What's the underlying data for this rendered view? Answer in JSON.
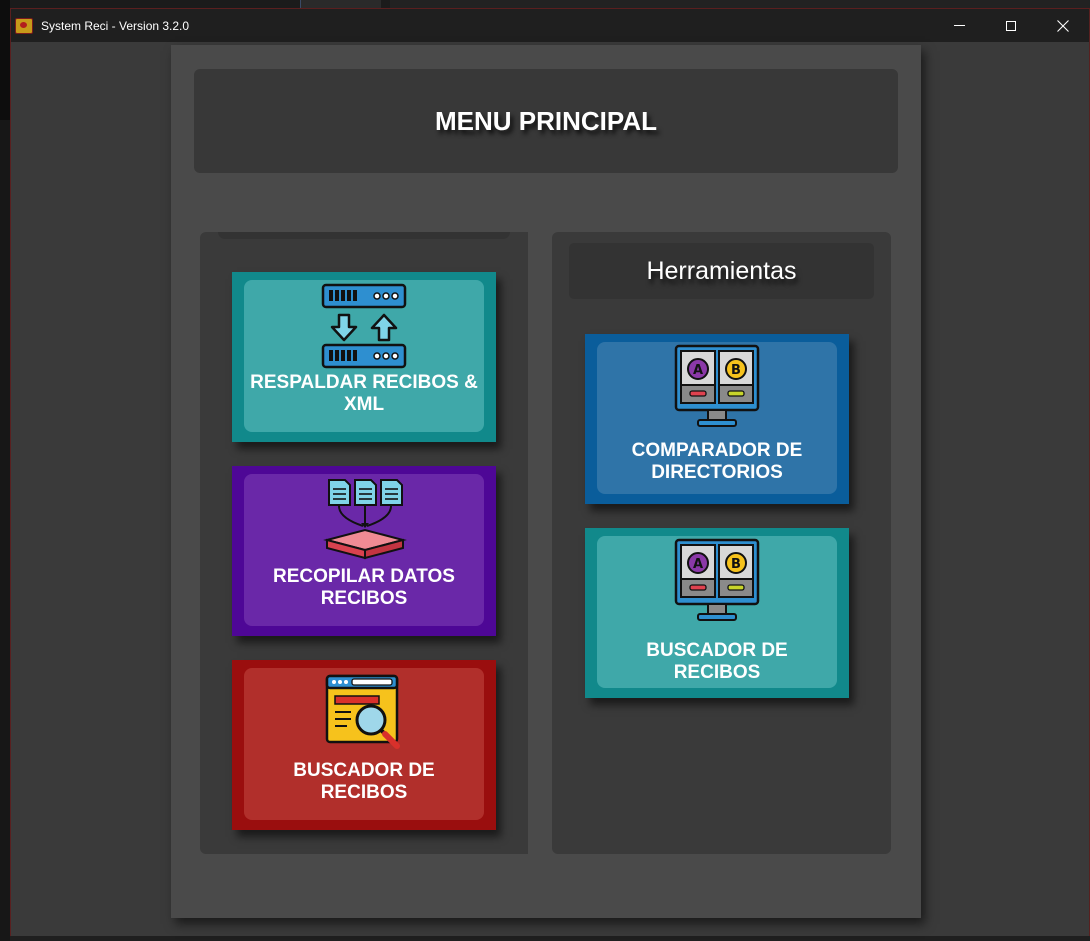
{
  "window": {
    "title": "System Reci - Version 3.2.0",
    "controls": [
      "minimize",
      "maximize",
      "close"
    ]
  },
  "header": {
    "title": "MENU PRINCIPAL"
  },
  "left_menu": {
    "buttons": [
      {
        "label": "RESPALDAR RECIBOS & XML",
        "icon": "server-transfer-icon",
        "color": "#11898b"
      },
      {
        "label": "RECOPILAR DATOS RECIBOS",
        "icon": "documents-merge-icon",
        "color": "#4e0796"
      },
      {
        "label": "BUSCADOR DE RECIBOS",
        "icon": "browser-search-icon",
        "color": "#9a0e0e"
      }
    ]
  },
  "tools": {
    "title": "Herramientas",
    "buttons": [
      {
        "label": "COMPARADOR DE DIRECTORIOS",
        "icon": "monitor-compare-ab-icon",
        "color": "#0a5d9b"
      },
      {
        "label": "BUSCADOR DE RECIBOS",
        "icon": "monitor-compare-ab-icon",
        "color": "#11898b"
      }
    ]
  },
  "colors": {
    "window_bg": "#3a3a3a",
    "panel_bg": "#4a4a4a",
    "titlebar_bg": "#1f1f1f"
  }
}
